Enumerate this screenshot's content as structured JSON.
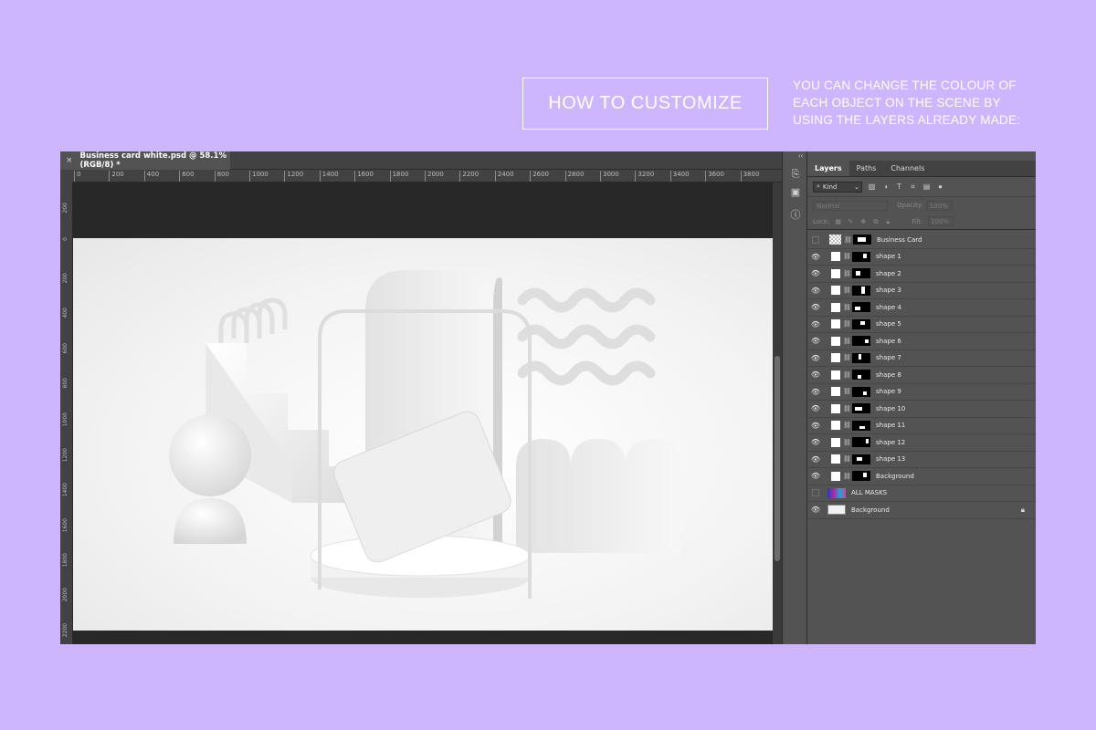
{
  "promo": {
    "heading": "HOW TO CUSTOMIZE",
    "description": "YOU CAN CHANGE THE COLOUR OF EACH OBJECT ON THE SCENE BY USING THE LAYERS ALREADY MADE:"
  },
  "document": {
    "tab_title": "Business card white.psd @ 58.1% (RGB/8) *",
    "close_glyph": "×"
  },
  "ruler": {
    "top_ticks": [
      "0",
      "200",
      "400",
      "600",
      "800",
      "1000",
      "1200",
      "1400",
      "1600",
      "1800",
      "2000",
      "2200",
      "2400",
      "2600",
      "2800",
      "3000",
      "3200",
      "3400",
      "3600",
      "3800"
    ],
    "left_ticks": [
      "200",
      "0",
      "200",
      "400",
      "600",
      "800",
      "1000",
      "1200",
      "1400",
      "1600",
      "1800",
      "2000",
      "2200"
    ]
  },
  "side_tools": {
    "history_icon": "history-icon",
    "comments_icon": "comments-icon",
    "info_icon": "info-icon",
    "collapse": "‹‹"
  },
  "panel": {
    "tabs": [
      "Layers",
      "Paths",
      "Channels"
    ],
    "kind_label": "Kind",
    "blend_mode": "Normal",
    "opacity_label": "Opacity:",
    "opacity_value": "100%",
    "lock_label": "Lock:",
    "fill_label": "Fill:",
    "fill_value": "100%"
  },
  "layers": [
    {
      "name": "Business Card",
      "visible": false,
      "thumb": "checker"
    },
    {
      "name": "shape 1",
      "visible": true,
      "thumb": "white"
    },
    {
      "name": "shape 2",
      "visible": true,
      "thumb": "white"
    },
    {
      "name": "shape 3",
      "visible": true,
      "thumb": "white"
    },
    {
      "name": "shape 4",
      "visible": true,
      "thumb": "white"
    },
    {
      "name": "shape 5",
      "visible": true,
      "thumb": "white"
    },
    {
      "name": "shape 6",
      "visible": true,
      "thumb": "white"
    },
    {
      "name": "shape 7",
      "visible": true,
      "thumb": "white"
    },
    {
      "name": "shape 8",
      "visible": true,
      "thumb": "white"
    },
    {
      "name": "shape 9",
      "visible": true,
      "thumb": "white"
    },
    {
      "name": "shape 10",
      "visible": true,
      "thumb": "white"
    },
    {
      "name": "shape 11",
      "visible": true,
      "thumb": "white"
    },
    {
      "name": "shape 12",
      "visible": true,
      "thumb": "white"
    },
    {
      "name": "shape 13",
      "visible": true,
      "thumb": "white"
    },
    {
      "name": "Background",
      "visible": true,
      "thumb": "white"
    },
    {
      "name": "ALL MASKS",
      "visible": false,
      "thumb": "color"
    },
    {
      "name": "Background",
      "visible": true,
      "thumb": "bg",
      "locked": true
    }
  ],
  "colors": {
    "page_background": "#cdb6fd",
    "app_background": "#535353",
    "canvas_background": "#282828"
  }
}
